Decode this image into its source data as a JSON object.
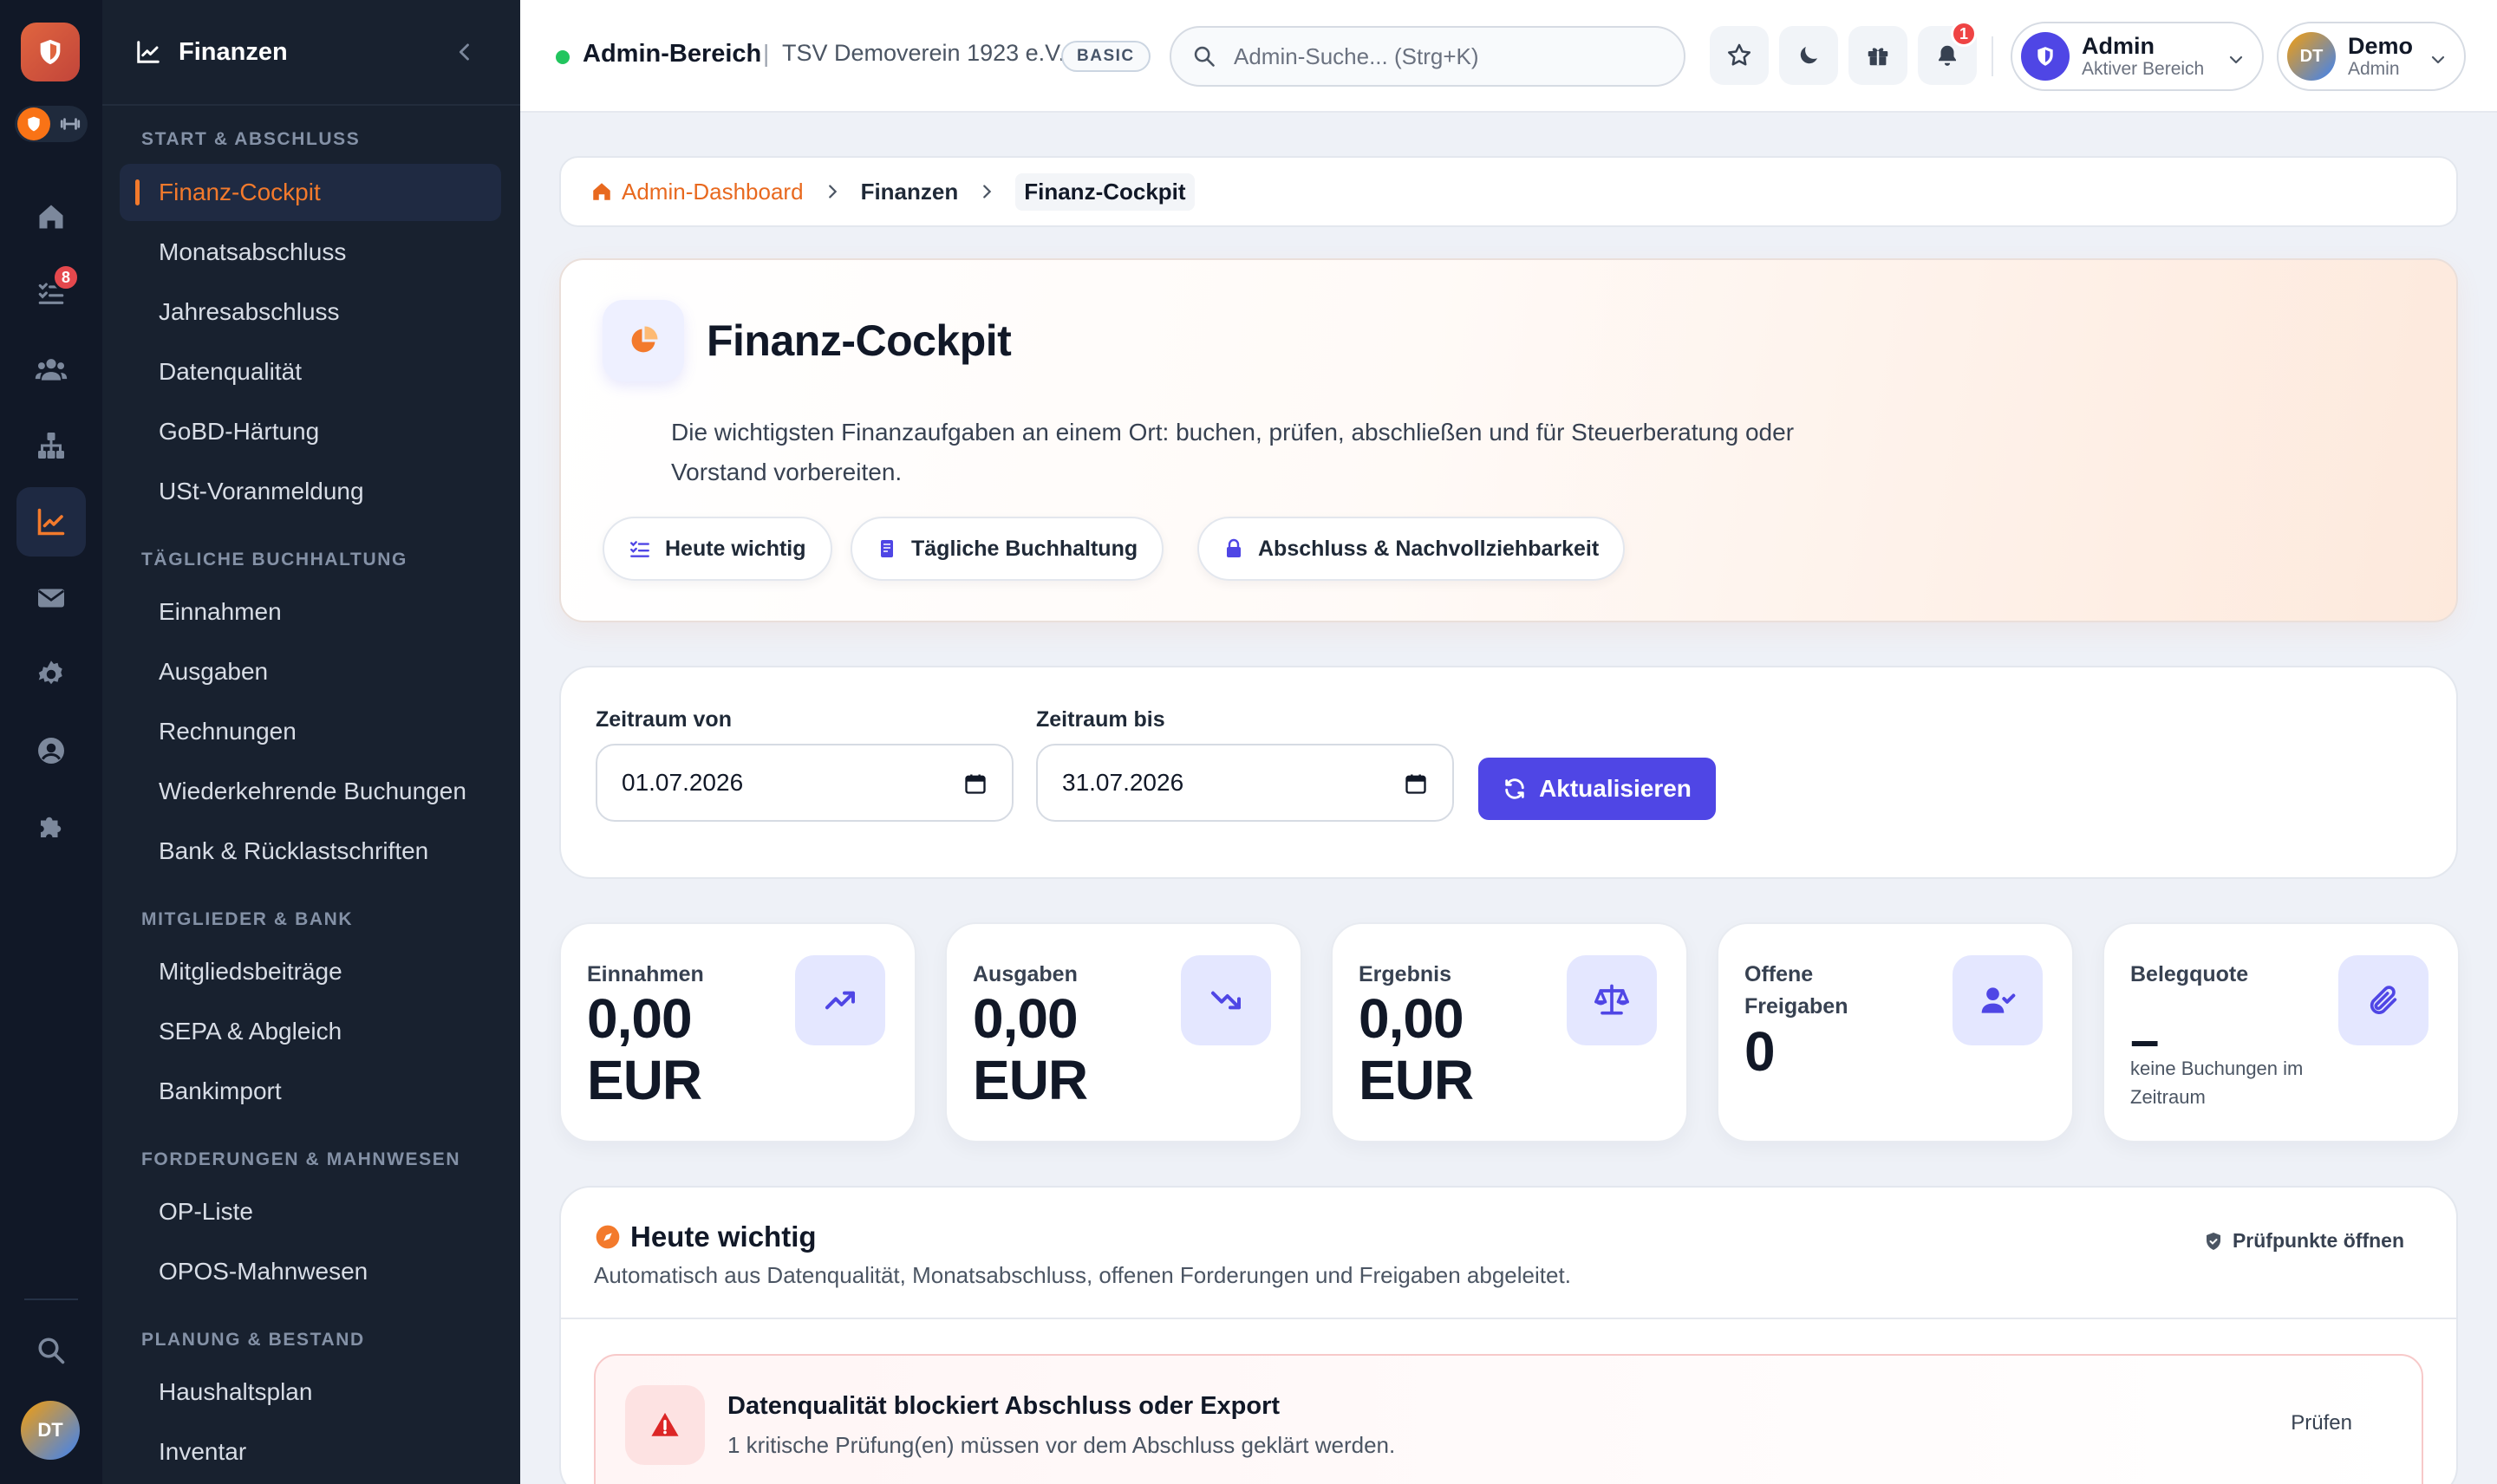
{
  "rail": {
    "badge_tasks": "8",
    "avatar_initials": "DT"
  },
  "sidebar": {
    "title": "Finanzen",
    "sections": [
      {
        "label": "START & ABSCHLUSS"
      },
      {
        "label": "TÄGLICHE BUCHHALTUNG"
      },
      {
        "label": "MITGLIEDER & BANK"
      },
      {
        "label": "FORDERUNGEN & MAHNWESEN"
      },
      {
        "label": "PLANUNG & BESTAND"
      }
    ],
    "items": [
      {
        "label": "Finanz-Cockpit"
      },
      {
        "label": "Monatsabschluss"
      },
      {
        "label": "Jahresabschluss"
      },
      {
        "label": "Datenqualität"
      },
      {
        "label": "GoBD-Härtung"
      },
      {
        "label": "USt-Voranmeldung"
      },
      {
        "label": "Einnahmen"
      },
      {
        "label": "Ausgaben"
      },
      {
        "label": "Rechnungen"
      },
      {
        "label": "Wiederkehrende Buchungen"
      },
      {
        "label": "Bank & Rücklastschriften"
      },
      {
        "label": "Mitgliedsbeiträge"
      },
      {
        "label": "SEPA & Abgleich"
      },
      {
        "label": "Bankimport"
      },
      {
        "label": "OP-Liste"
      },
      {
        "label": "OPOS-Mahnwesen"
      },
      {
        "label": "Haushaltsplan"
      },
      {
        "label": "Inventar"
      }
    ]
  },
  "topbar": {
    "area": "Admin-Bereich",
    "separator": "|",
    "club": "TSV Demoverein 1923 e.V.",
    "plan_badge": "BASIC",
    "search_placeholder": "Admin-Suche... (Strg+K)",
    "notification_count": "1",
    "role_chip": {
      "title": "Admin",
      "subtitle": "Aktiver Bereich"
    },
    "user_chip": {
      "initials": "DT",
      "title": "Demo",
      "subtitle": "Admin"
    }
  },
  "breadcrumb": {
    "home": "Admin-Dashboard",
    "section": "Finanzen",
    "current": "Finanz-Cockpit"
  },
  "hero": {
    "title": "Finanz-Cockpit",
    "description": "Die wichtigsten Finanzaufgaben an einem Ort: buchen, prüfen, abschließen und für Steuerberatung oder Vorstand vorbereiten.",
    "buttons": [
      {
        "label": "Heute wichtig"
      },
      {
        "label": "Tägliche Buchhaltung"
      },
      {
        "label": "Abschluss & Nachvollziehbarkeit"
      }
    ]
  },
  "filter": {
    "from_label": "Zeitraum von",
    "from_value": "01.07.2026",
    "to_label": "Zeitraum bis",
    "to_value": "31.07.2026",
    "refresh_label": "Aktualisieren"
  },
  "kpis": [
    {
      "label": "Einnahmen",
      "value": "0,00 EUR",
      "icon": "trending-up-icon"
    },
    {
      "label": "Ausgaben",
      "value": "0,00 EUR",
      "icon": "trending-down-icon"
    },
    {
      "label": "Ergebnis",
      "value": "0,00 EUR",
      "icon": "scale-icon"
    },
    {
      "label": "Offene Freigaben",
      "value": "0",
      "icon": "user-check-icon"
    },
    {
      "label": "Belegquote",
      "value": "–",
      "sub": "keine Buchungen im Zeitraum",
      "icon": "paperclip-icon"
    }
  ],
  "today": {
    "title": "Heute wichtig",
    "subtitle": "Automatisch aus Datenqualität, Monatsabschluss, offenen Forderungen und Freigaben abgeleitet.",
    "link": "Prüfpunkte öffnen",
    "alert": {
      "title": "Datenqualität blockiert Abschluss oder Export",
      "subtitle": "1 kritische Prüfung(en) müssen vor dem Abschluss geklärt werden.",
      "button": "Prüfen"
    }
  },
  "colors": {
    "accent_orange": "#f37a2c",
    "primary_indigo": "#4f46e5",
    "sidebar_bg": "#18212f",
    "danger": "#ef4444"
  }
}
